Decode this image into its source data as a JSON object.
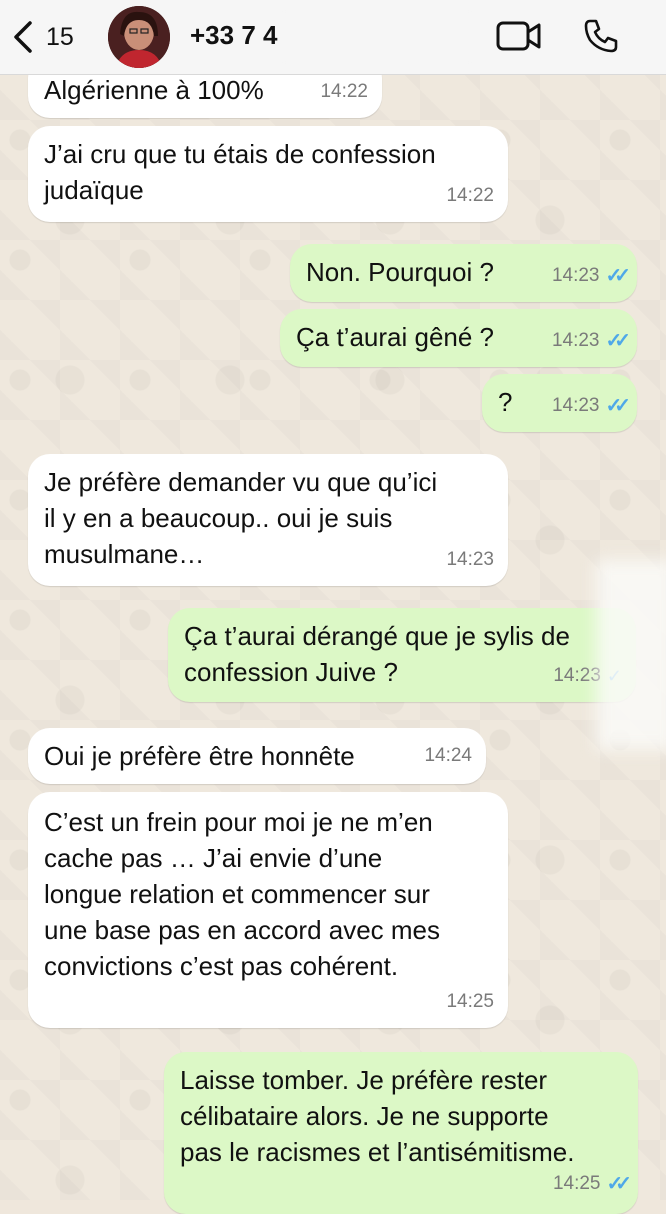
{
  "header": {
    "back_count": "15",
    "contact_name": "+33 7 4"
  },
  "messages": [
    {
      "text": "Algérienne à 100%",
      "time": "14:22"
    },
    {
      "text": "J’ai cru que tu étais de confession\njudaïque",
      "time": "14:22"
    },
    {
      "text": "Non. Pourquoi ?",
      "time": "14:23"
    },
    {
      "text": "Ça t’aurai gêné ?",
      "time": "14:23"
    },
    {
      "text": "?",
      "time": "14:23"
    },
    {
      "text": "Je préfère demander vu que qu’ici\nil y en a beaucoup.. oui je suis\nmusulmane…",
      "time": "14:23"
    },
    {
      "text": "Ça t’aurai dérangé que je sylis de\nconfession Juive ?",
      "time": "14:23"
    },
    {
      "text": "Oui je préfère être honnête",
      "time": "14:24"
    },
    {
      "text": "C’est un frein pour moi je ne m’en\ncache pas … J’ai envie d’une\nlongue relation et commencer sur\nune base pas en accord avec mes\nconvictions c’est pas cohérent.",
      "time": "14:25"
    },
    {
      "text": "Laisse tomber. Je préfère rester\ncélibataire alors. Je ne supporte\npas le racismes et l’antisémitisme.",
      "time": "14:25"
    }
  ],
  "icons": {
    "back": "chevron-left-icon",
    "video": "video-camera-icon",
    "phone": "phone-icon",
    "read": "double-check-icon"
  },
  "colors": {
    "incoming_bubble": "#ffffff",
    "outgoing_bubble": "#dcf8c6",
    "read_ticks": "#4fa8e8",
    "header_bg": "#f6f6f6",
    "chat_bg": "#efe8dd"
  }
}
